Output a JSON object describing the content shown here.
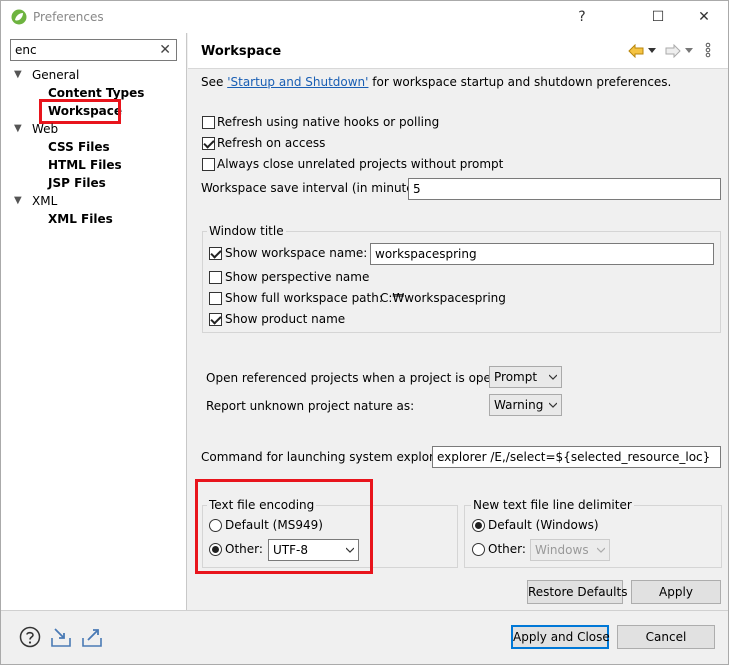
{
  "window": {
    "title": "Preferences",
    "help_glyph": "?",
    "maximize_glyph": "☐",
    "close_glyph": "✕"
  },
  "filter": {
    "value": "enc",
    "clear_glyph": "✕"
  },
  "tree": [
    {
      "label": "General",
      "level": 0,
      "expanded": true
    },
    {
      "label": "Content Types",
      "level": 1
    },
    {
      "label": "Workspace",
      "level": 1,
      "selected": true
    },
    {
      "label": "Web",
      "level": 0,
      "expanded": true
    },
    {
      "label": "CSS Files",
      "level": 1
    },
    {
      "label": "HTML Files",
      "level": 1
    },
    {
      "label": "JSP Files",
      "level": 1
    },
    {
      "label": "XML",
      "level": 0,
      "expanded": true
    },
    {
      "label": "XML Files",
      "level": 1
    }
  ],
  "page": {
    "title": "Workspace",
    "intro_prefix": "See ",
    "intro_link": "'Startup and Shutdown'",
    "intro_suffix": " for workspace startup and shutdown preferences."
  },
  "options": {
    "refresh_native": {
      "label": "Refresh using native hooks or polling",
      "checked": false
    },
    "refresh_access": {
      "label": "Refresh on access",
      "checked": true
    },
    "close_unrelated": {
      "label": "Always close unrelated projects without prompt",
      "checked": false
    },
    "save_interval_label": "Workspace save interval (in minutes):",
    "save_interval_value": "5"
  },
  "window_title": {
    "group_label": "Window title",
    "show_workspace_name": {
      "label": "Show workspace name:",
      "checked": true,
      "value": "workspacespring"
    },
    "show_perspective_name": {
      "label": "Show perspective name",
      "checked": false
    },
    "show_full_path": {
      "label": "Show full workspace path:",
      "checked": false,
      "value": "C:₩workspacespring"
    },
    "show_product_name": {
      "label": "Show product name",
      "checked": true
    }
  },
  "projects": {
    "open_referenced_label": "Open referenced projects when a project is opened:",
    "open_referenced_value": "Prompt",
    "unknown_nature_label": "Report unknown project nature as:",
    "unknown_nature_value": "Warning"
  },
  "explorer": {
    "label": "Command for launching system explorer:",
    "value": "explorer /E,/select=${selected_resource_loc}"
  },
  "encoding": {
    "group_label": "Text file encoding",
    "default_label": "Default (MS949)",
    "other_label": "Other:",
    "other_value": "UTF-8",
    "selected": "other"
  },
  "line_delimiter": {
    "group_label": "New text file line delimiter",
    "default_label": "Default (Windows)",
    "other_label": "Other:",
    "other_value": "Windows",
    "selected": "default"
  },
  "buttons": {
    "restore_defaults": "Restore Defaults",
    "apply": "Apply",
    "apply_and_close": "Apply and Close",
    "cancel": "Cancel"
  },
  "colors": {
    "annotation_red": "#e8141c",
    "link_blue": "#1a5fb4",
    "primary_border": "#0078d7"
  },
  "icons": {
    "app": "spring-leaf-icon",
    "back": "back-arrow-icon",
    "forward": "forward-arrow-icon",
    "menu": "view-menu-icon",
    "help": "help-icon",
    "import": "import-icon",
    "export": "export-icon"
  }
}
